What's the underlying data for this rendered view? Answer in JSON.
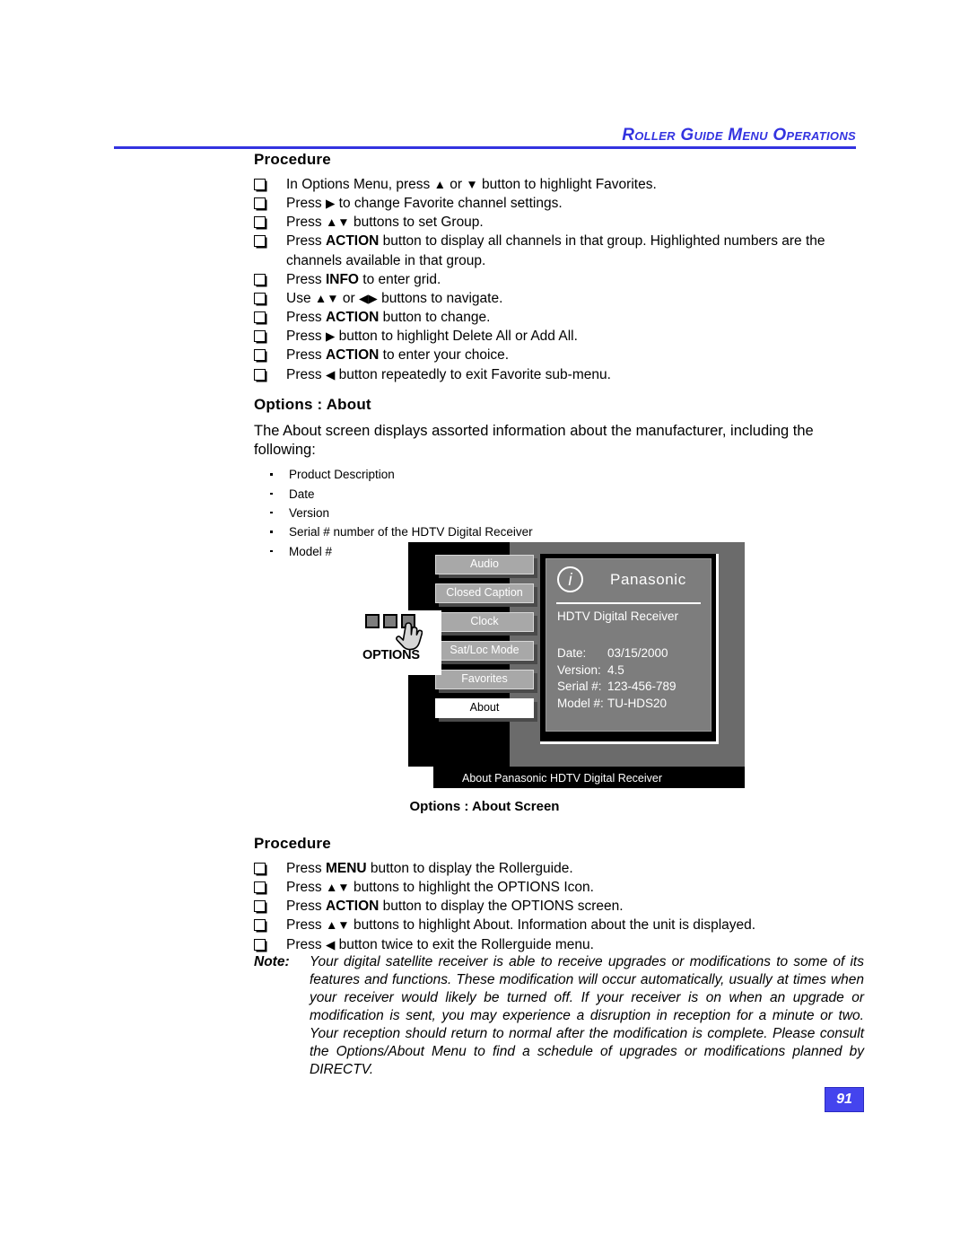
{
  "header": {
    "title": "Roller Guide Menu Operations"
  },
  "section1": {
    "heading": "Procedure",
    "steps": [
      {
        "pre": "In Options Menu, press ",
        "sym1": "▲",
        "mid": " or ",
        "sym2": "▼",
        "post": " button to highlight Favorites."
      },
      {
        "pre": "Press ",
        "sym1": "▶",
        "mid": "",
        "sym2": "",
        "post": " to change Favorite channel settings."
      },
      {
        "pre": "Press ",
        "sym1": "▲▼",
        "mid": "",
        "sym2": "",
        "post": " buttons to set Group."
      },
      {
        "pre": "Press ",
        "bold": "ACTION",
        "post": " button to display all channels in that group. Highlighted numbers are the channels available in that group."
      },
      {
        "pre": "Press ",
        "bold": "INFO",
        "post": " to enter grid."
      },
      {
        "pre": "Use  ",
        "sym1": "▲▼",
        "mid": "  or ",
        "sym2": "◀▶",
        "post": " buttons to navigate."
      },
      {
        "pre": "Press ",
        "bold": "ACTION",
        "post": " button to change."
      },
      {
        "pre": "Press ",
        "sym1": "▶",
        "mid": "",
        "sym2": "",
        "post": " button to highlight Delete All or Add All."
      },
      {
        "pre": "Press ",
        "bold": "ACTION",
        "post": " to enter your choice."
      },
      {
        "pre": "Press ",
        "sym1": "◀",
        "mid": "",
        "sym2": "",
        "post": " button repeatedly to exit Favorite sub-menu."
      }
    ]
  },
  "section2": {
    "heading": "Options : About",
    "intro": "The About screen displays assorted information about the manufacturer, including the following:",
    "bullets": [
      "Product Description",
      "Date",
      "Version",
      "Serial # number of the HDTV Digital Receiver",
      "Model #"
    ]
  },
  "tv_screen": {
    "menu_items": [
      {
        "label": "Audio",
        "selected": false
      },
      {
        "label": "Closed Caption",
        "selected": false
      },
      {
        "label": "Clock",
        "selected": false
      },
      {
        "label": "Sat/Loc Mode",
        "selected": false
      },
      {
        "label": "Favorites",
        "selected": false
      },
      {
        "label": "About",
        "selected": true
      }
    ],
    "info_panel": {
      "icon": "info-icon",
      "brand": "Panasonic",
      "subtitle": "HDTV Digital Receiver",
      "rows": [
        {
          "key": "Date:",
          "value": "03/15/2000"
        },
        {
          "key": "Version:",
          "value": "4.5"
        },
        {
          "key": "Serial #:",
          "value": "123-456-789"
        },
        {
          "key": "Model #:",
          "value": "TU-HDS20"
        }
      ]
    },
    "status_bar": "About Panasonic HDTV Digital Receiver",
    "options_callout": {
      "label": "OPTIONS"
    }
  },
  "figure_caption": "Options : About Screen",
  "section3": {
    "heading": "Procedure",
    "steps": [
      {
        "pre": "Press ",
        "bold": "MENU",
        "post": " button to display the Rollerguide."
      },
      {
        "pre": "Press ",
        "sym1": "▲▼",
        "mid": "",
        "sym2": "",
        "post": " buttons to highlight the OPTIONS Icon."
      },
      {
        "pre": "Press ",
        "bold": "ACTION",
        "post": " button to display the OPTIONS screen."
      },
      {
        "pre": "Press ",
        "sym1": "▲▼",
        "mid": "",
        "sym2": "",
        "post": " buttons to highlight About. Information about the unit is displayed."
      },
      {
        "pre": "Press ",
        "sym1": "◀",
        "mid": "",
        "sym2": "",
        "post": "  button twice to exit the Rollerguide menu."
      }
    ]
  },
  "note": {
    "label": "Note:",
    "text": "Your digital satellite receiver is able to receive upgrades or modifications to some of its features and functions. These modification will occur automatically, usually at times when your receiver would likely be turned off. If your receiver is on when an upgrade or modification is sent, you may experience a disruption in reception for a minute or two. Your reception should return to normal after the modification is complete. Please consult the Options/About Menu to find a schedule of upgrades or modifications planned by DIRECTV."
  },
  "page_number": "91",
  "colors": {
    "accent_blue": "#3333e0",
    "page_badge": "#4444ee"
  }
}
